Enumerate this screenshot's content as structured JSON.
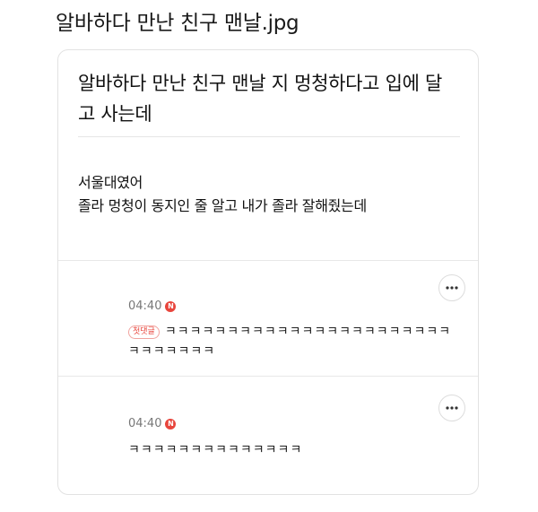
{
  "page": {
    "title": "알바하다 만난 친구 맨날.jpg"
  },
  "post": {
    "title": "알바하다 만난 친구 맨날 지 멍청하다고 입에 달고 사는데",
    "body_lines": [
      "서울대였어",
      "졸라 멍청이 동지인 줄 알고 내가 졸라 잘해줬는데"
    ]
  },
  "comments": [
    {
      "time": "04:40",
      "badge": "N",
      "tag": "첫댓글",
      "text": "ㅋㅋㅋㅋㅋㅋㅋㅋㅋㅋㅋㅋㅋㅋㅋㅋㅋㅋㅋㅋㅋㅋㅋㅋㅋㅋㅋㅋㅋㅋ",
      "more_icon": "more-horizontal-icon"
    },
    {
      "time": "04:40",
      "badge": "N",
      "text": "ㅋㅋㅋㅋㅋㅋㅋㅋㅋㅋㅋㅋㅋㅋ",
      "more_icon": "more-horizontal-icon"
    }
  ],
  "colors": {
    "badge": "#e8453c",
    "divider": "#e8e8e8",
    "card_border": "#e2e2e2"
  }
}
